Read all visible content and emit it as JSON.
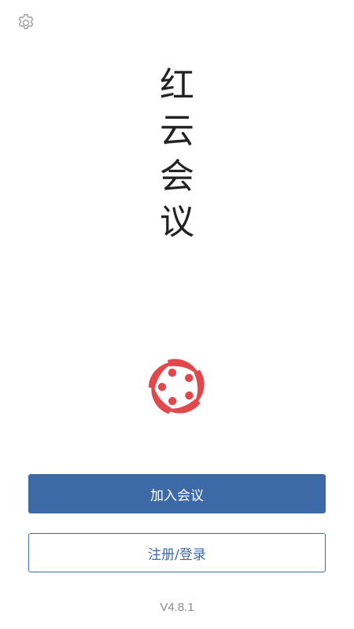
{
  "app": {
    "title_chars": [
      "红",
      "云",
      "会",
      "议"
    ]
  },
  "icons": {
    "settings": "gear-icon",
    "logo": "app-logo"
  },
  "colors": {
    "primary": "#3d6aa6",
    "logo": "#e0484c",
    "version_text": "#8a8a8a"
  },
  "actions": {
    "join_label": "加入会议",
    "register_login_label": "注册/登录"
  },
  "footer": {
    "version": "V4.8.1"
  }
}
